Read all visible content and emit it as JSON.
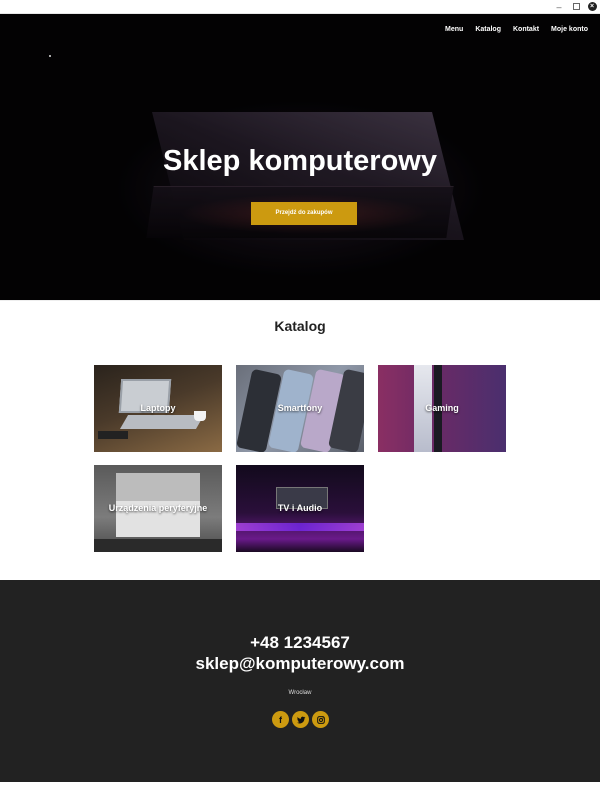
{
  "window": {
    "minimize_glyph": "–",
    "close_glyph": "×"
  },
  "nav": {
    "items": [
      {
        "label": "Menu"
      },
      {
        "label": "Katalog"
      },
      {
        "label": "Kontakt"
      },
      {
        "label": "Moje konto"
      }
    ]
  },
  "hero": {
    "title": "Sklep komputerowy",
    "cta_label": "Przejdź do zakupów",
    "cta_color": "#cc9a10"
  },
  "catalog": {
    "title": "Katalog",
    "tiles": [
      {
        "label": "Laptopy"
      },
      {
        "label": "Smartfony"
      },
      {
        "label": "Gaming"
      },
      {
        "label": "Urządzenia peryferyjne"
      },
      {
        "label": "TV i Audio"
      }
    ]
  },
  "footer": {
    "phone": "+48 1234567",
    "email": "sklep@komputerowy.com",
    "city": "Wrocław",
    "social": [
      {
        "icon": "facebook-icon",
        "glyph": "f"
      },
      {
        "icon": "twitter-icon"
      },
      {
        "icon": "instagram-icon"
      }
    ],
    "background": "#222222",
    "accent": "#cc9a10"
  }
}
